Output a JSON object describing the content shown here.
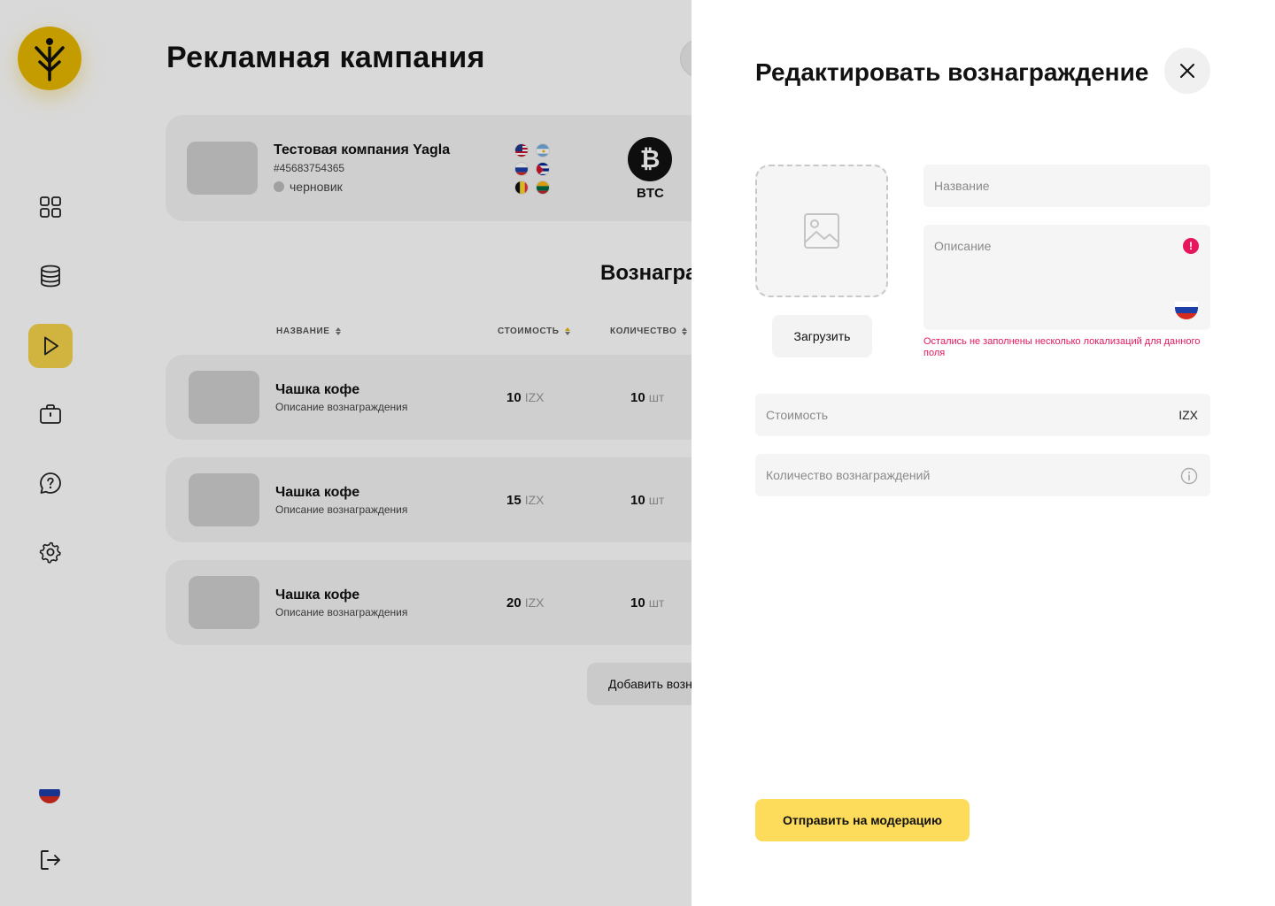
{
  "app": {
    "page_title": "Рекламная кампания",
    "section_title": "Вознагра",
    "brand_color": "#e7b800",
    "accent_active": "#f5d44a"
  },
  "sidebar": {
    "items": [
      {
        "icon": "dashboard-grid-icon",
        "active": false
      },
      {
        "icon": "database-coins-icon",
        "active": false
      },
      {
        "icon": "play-icon",
        "active": true
      },
      {
        "icon": "briefcase-icon",
        "active": false
      },
      {
        "icon": "help-chat-icon",
        "active": false
      },
      {
        "icon": "gear-icon",
        "active": false
      }
    ],
    "language_icon": "russia-flag-icon",
    "logout_icon": "logout-icon"
  },
  "campaign": {
    "name": "Тестовая компания Yagla",
    "id": "#45683754365",
    "status": "черновик",
    "currency": "BTC",
    "flags": [
      "us-flag",
      "argentina-flag",
      "russia-flag",
      "cuba-flag",
      "belgium-flag",
      "lithuania-flag"
    ]
  },
  "table": {
    "headers": {
      "name": "НАЗВАНИЕ",
      "cost": "СТОИМОСТЬ",
      "qty": "КОЛИЧЕСТВО"
    },
    "rows": [
      {
        "title": "Чашка кофе",
        "desc": "Описание вознаграждения",
        "cost": "10",
        "cost_unit": "IZX",
        "qty": "10",
        "qty_unit": "шт"
      },
      {
        "title": "Чашка кофе",
        "desc": "Описание вознаграждения",
        "cost": "15",
        "cost_unit": "IZX",
        "qty": "10",
        "qty_unit": "шт"
      },
      {
        "title": "Чашка кофе",
        "desc": "Описание вознаграждения",
        "cost": "20",
        "cost_unit": "IZX",
        "qty": "10",
        "qty_unit": "шт"
      }
    ],
    "add_button": "Добавить возн"
  },
  "drawer": {
    "title": "Редактировать вознаграждение",
    "upload_button": "Загрузить",
    "name_placeholder": "Название",
    "description_placeholder": "Описание",
    "description_error": "Остались не заполнены несколько локализаций для данного поля",
    "cost_placeholder": "Стоимость",
    "cost_suffix": "IZX",
    "quantity_placeholder": "Количество вознаграждений",
    "submit_button": "Отправить на модерацию",
    "error_color": "#e6175c",
    "submit_color": "#fddc5c"
  }
}
